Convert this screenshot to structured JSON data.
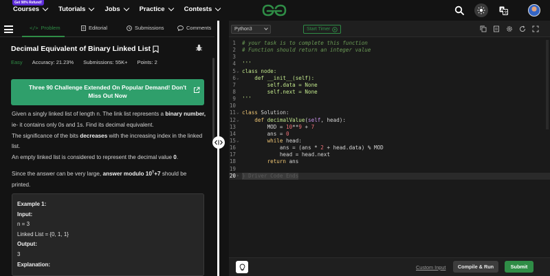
{
  "topnav": {
    "promo_badge": "Get 90% Refund!",
    "menu": [
      {
        "label": "Courses"
      },
      {
        "label": "Tutorials"
      },
      {
        "label": "Jobs"
      },
      {
        "label": "Practice"
      },
      {
        "label": "Contests"
      }
    ],
    "brand_color": "#2f8d46",
    "icons": [
      "search-icon",
      "theme-toggle-icon",
      "translate-icon",
      "user-avatar"
    ]
  },
  "left_panel": {
    "tabs": [
      {
        "label": "Problem",
        "icon": "code-icon",
        "active": true
      },
      {
        "label": "Editorial",
        "icon": "document-icon"
      },
      {
        "label": "Submissions",
        "icon": "clock-icon"
      },
      {
        "label": "Comments",
        "icon": "comment-icon"
      }
    ],
    "problem": {
      "title": "Decimal Equivalent of Binary Linked List",
      "difficulty": "Easy",
      "accuracy": "Accuracy: 21.23%",
      "submissions": "Submissions: 55K+",
      "points": "Points: 2"
    },
    "banner": "Three 90 Challenge Extended On Popular Demand! Don't Miss Out Now",
    "description": {
      "p1_a": "Given a singly linked list of length n. The link list represents a ",
      "p1_b": "binary number,",
      "p1_c": " ie- it contains only 0s and 1s. Find its decimal equivalent.",
      "p2_a": "The significance of the bits ",
      "p2_b": "decreases",
      "p2_c": " with the increasing index in the linked list.",
      "p3_a": "An empty linked list is considered to represent the decimal value ",
      "p3_b": "0",
      "p3_c": ".",
      "p4_a": "Since the answer can be very large, ",
      "p4_b": "answer modulo 10",
      "p4_sup": "9",
      "p4_c": "+7",
      "p4_d": " should be printed."
    },
    "example": {
      "heading": "Example 1:",
      "input_label": "Input:",
      "input_line1": "n = 3",
      "input_line2": "Linked List = {0, 1, 1}",
      "output_label": "Output:",
      "output_value": "3",
      "explanation_label": "Explanation:"
    }
  },
  "editor": {
    "language": "Python3",
    "timer_label": "Start Timer",
    "custom_input": "Custom Input",
    "run_label": "Compile & Run",
    "submit_label": "Submit",
    "ghost_text": "} Driver Code Ends",
    "lines": [
      "# your task is to complete this function",
      "# Function should return an integer value",
      "",
      "'''",
      "class node:",
      "    def __init__(self):",
      "        self.data = None",
      "        self.next = None",
      "'''",
      "",
      "class Solution:",
      "    def decimalValue(self, head):",
      "        MOD = 10**9 + 7",
      "        ans = 0",
      "        while head:",
      "            ans = (ans * 2 + head.data) % MOD",
      "            head = head.next",
      "        return ans",
      "",
      ""
    ]
  }
}
